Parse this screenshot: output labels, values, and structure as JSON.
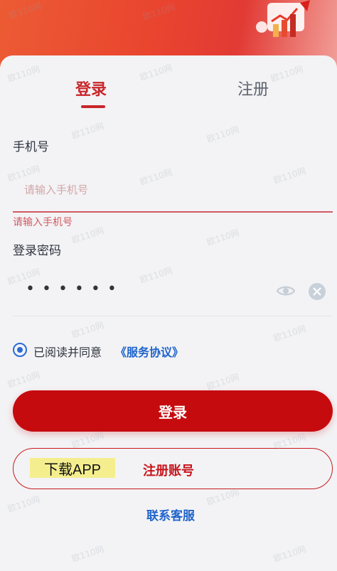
{
  "tabs": {
    "login": "登录",
    "register": "注册"
  },
  "form": {
    "phone_label": "手机号",
    "phone_placeholder": "请输入手机号",
    "phone_error": "请输入手机号",
    "password_label": "登录密码",
    "password_value": "••••••"
  },
  "agreement": {
    "text": "已阅读并同意",
    "link": "《服务协议》",
    "checked": true
  },
  "buttons": {
    "login": "登录",
    "download_app": "下载APP",
    "register_account": "注册账号",
    "contact_service": "联系客服"
  },
  "colors": {
    "brand_red": "#c60b0f",
    "link_blue": "#1e63cc",
    "error_red": "#d35a62"
  },
  "watermark": "欧110网"
}
